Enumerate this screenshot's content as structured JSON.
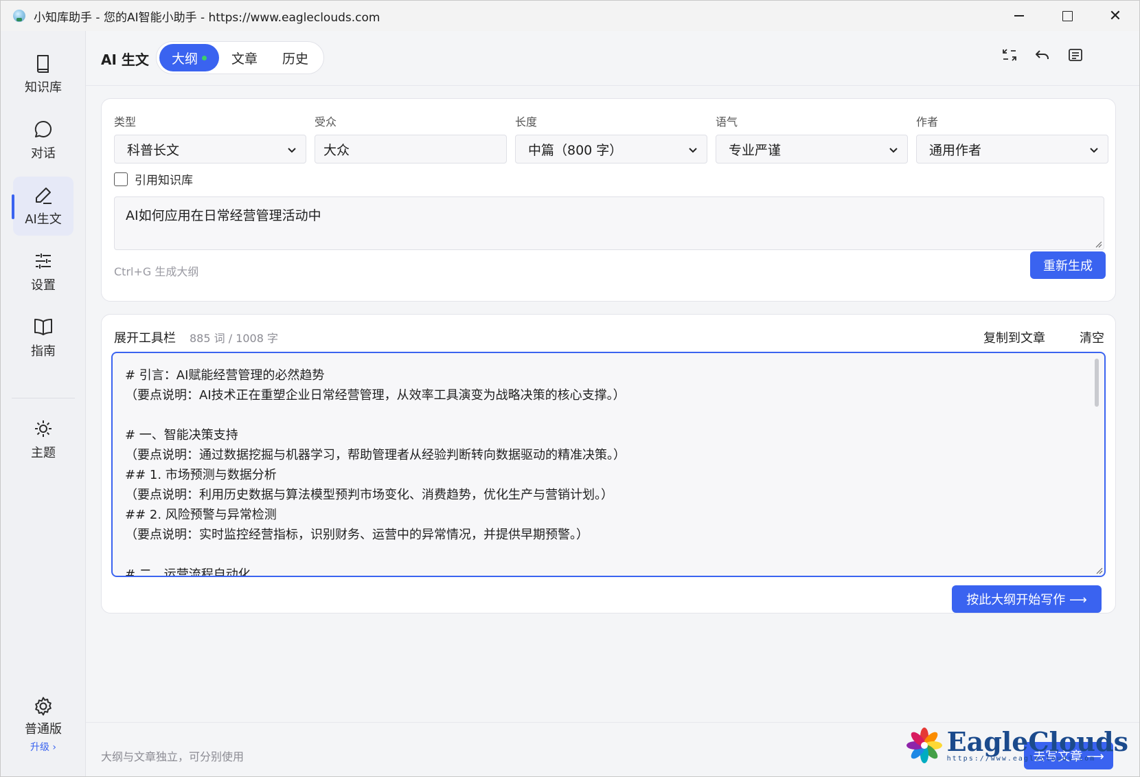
{
  "window": {
    "title": "小知库助手 - 您的AI智能小助手 - https://www.eagleclouds.com",
    "close_glyph": "✕"
  },
  "sidebar": {
    "items": [
      {
        "label": "知识库",
        "icon": "book-icon"
      },
      {
        "label": "对话",
        "icon": "chat-bubble-icon"
      },
      {
        "label": "AI生文",
        "icon": "pen-icon",
        "active": true
      },
      {
        "label": "设置",
        "icon": "sliders-icon"
      },
      {
        "label": "指南",
        "icon": "open-book-icon"
      },
      {
        "label": "主题",
        "icon": "sun-icon"
      }
    ],
    "plan": {
      "label": "普通版",
      "upgrade": "升级 ›",
      "icon": "gear-icon"
    }
  },
  "header": {
    "title": "AI 生文",
    "tabs": [
      {
        "label": "大纲",
        "active": true
      },
      {
        "label": "文章"
      },
      {
        "label": "历史"
      }
    ]
  },
  "form": {
    "type": {
      "label": "类型",
      "value": "科普长文"
    },
    "audience": {
      "label": "受众",
      "value": "大众"
    },
    "length": {
      "label": "长度",
      "value": "中篇（800 字）"
    },
    "tone": {
      "label": "语气",
      "value": "专业严谨"
    },
    "author": {
      "label": "作者",
      "value": "通用作者"
    },
    "use_kb_label": "引用知识库",
    "topic": "AI如何应用在日常经营管理活动中",
    "hint": "Ctrl+G 生成大纲",
    "regenerate": "重新生成"
  },
  "outline": {
    "toolbar_label": "展开工具栏",
    "count": "885 词 / 1008 字",
    "copy_to_article": "复制到文章",
    "clear": "清空",
    "text": "# 引言：AI赋能经营管理的必然趋势\n（要点说明：AI技术正在重塑企业日常经营管理，从效率工具演变为战略决策的核心支撑。）\n\n# 一、智能决策支持\n（要点说明：通过数据挖掘与机器学习，帮助管理者从经验判断转向数据驱动的精准决策。）\n## 1. 市场预测与数据分析\n（要点说明：利用历史数据与算法模型预判市场变化、消费趋势，优化生产与营销计划。）\n## 2. 风险预警与异常检测\n（要点说明：实时监控经营指标，识别财务、运营中的异常情况，并提供早期预警。）\n\n# 二、运营流程自动化",
    "start_writing": "按此大纲开始写作 ⟶"
  },
  "footer": {
    "note": "大纲与文章独立，可分别使用",
    "goto_article": "去写文章 ⟶"
  },
  "watermark": {
    "brand": "EagleClouds",
    "url": "https://www.eagleclouds.com"
  },
  "colors": {
    "accent": "#3a63f0",
    "tab_dot": "#3ccf6a"
  }
}
